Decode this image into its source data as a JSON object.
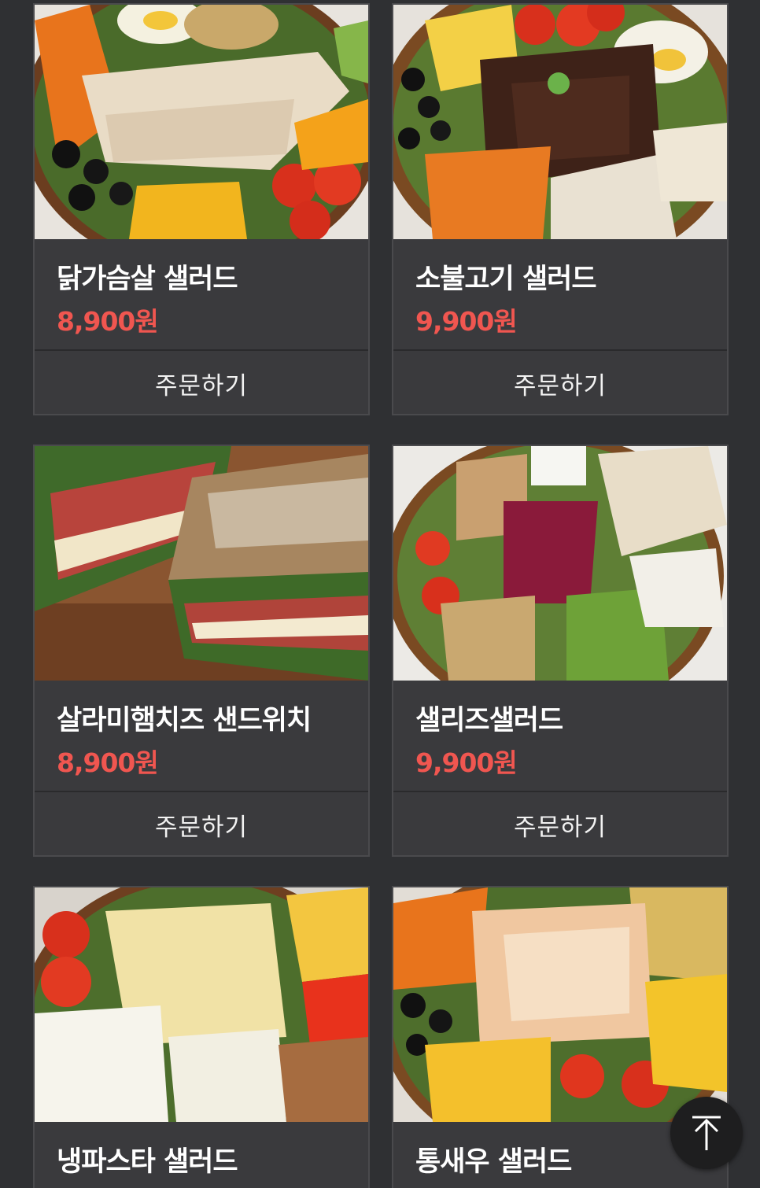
{
  "order_label": "주문하기",
  "colors": {
    "background": "#2f3033",
    "card": "#3a3a3d",
    "price": "#f05650",
    "text": "#ffffff"
  },
  "products": [
    {
      "name": "닭가슴살 샐러드",
      "price": "8,900원",
      "order_label": "주문하기",
      "image": "chicken-breast-salad-photo"
    },
    {
      "name": "소불고기 샐러드",
      "price": "9,900원",
      "order_label": "주문하기",
      "image": "beef-bulgogi-salad-photo"
    },
    {
      "name": "살라미햄치즈 샌드위치",
      "price": "8,900원",
      "order_label": "주문하기",
      "image": "salami-ham-cheese-sandwich-photo"
    },
    {
      "name": "샐리즈샐러드",
      "price": "9,900원",
      "order_label": "주문하기",
      "image": "sallys-salad-photo"
    },
    {
      "name": "냉파스타 샐러드",
      "image": "cold-pasta-salad-photo"
    },
    {
      "name": "통새우 샐러드",
      "image": "whole-shrimp-salad-photo"
    }
  ],
  "scroll_top_icon": "arrow-up-icon"
}
